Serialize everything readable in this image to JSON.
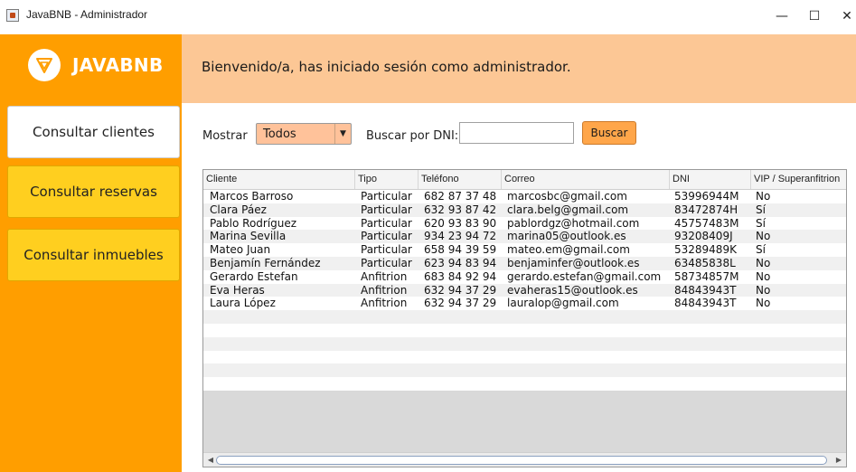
{
  "window": {
    "title": "JavaBNB - Administrador",
    "minimize": "—",
    "maximize": "☐",
    "close": "✕"
  },
  "brand": {
    "name": "JAVABNB",
    "colors": {
      "sidebar": "#ff9e00",
      "header": "#fcc795",
      "nav_active": "#ffffff",
      "nav_inactive": "#ffcf1f",
      "button": "#ffa64a"
    }
  },
  "sidebar": {
    "items": [
      {
        "label": "Consultar clientes",
        "active": true
      },
      {
        "label": "Consultar reservas",
        "active": false
      },
      {
        "label": "Consultar inmuebles",
        "active": false
      }
    ]
  },
  "header": {
    "welcome": "Bienvenido/a, has iniciado sesión como administrador."
  },
  "filters": {
    "show_label": "Mostrar",
    "show_selected": "Todos",
    "dni_label": "Buscar por DNI:",
    "dni_value": "",
    "search_button": "Buscar"
  },
  "table": {
    "columns": [
      "Cliente",
      "Tipo",
      "Teléfono",
      "Correo",
      "DNI",
      "VIP / Superanfitrion"
    ],
    "rows": [
      [
        "Marcos Barroso",
        "Particular",
        "682 87 37 48",
        "marcosbc@gmail.com",
        "53996944M",
        "No"
      ],
      [
        "Clara Páez",
        "Particular",
        "632 93 87 42",
        "clara.belg@gmail.com",
        "83472874H",
        "Sí"
      ],
      [
        "Pablo Rodríguez",
        "Particular",
        "620 93 83 90",
        "pablordgz@hotmail.com",
        "45757483M",
        "Sí"
      ],
      [
        "Marina Sevilla",
        "Particular",
        "934 23 94 72",
        "marina05@outlook.es",
        "93208409J",
        "No"
      ],
      [
        "Mateo Juan",
        "Particular",
        "658 94 39 59",
        "mateo.em@gmail.com",
        "53289489K",
        "Sí"
      ],
      [
        "Benjamín Fernández",
        "Particular",
        "623 94 83 94",
        "benjaminfer@outlook.es",
        "63485838L",
        "No"
      ],
      [
        "Gerardo Estefan",
        "Anfitrion",
        "683 84 92 94",
        "gerardo.estefan@gmail.com",
        "58734857M",
        "No"
      ],
      [
        "Eva Heras",
        "Anfitrion",
        "632 94 37 29",
        "evaheras15@outlook.es",
        "84843943T",
        "No"
      ],
      [
        "Laura López",
        "Anfitrion",
        "632 94 37 29",
        "lauralop@gmail.com",
        "84843943T",
        "No"
      ]
    ]
  },
  "icons": {
    "app": "java-cup-icon",
    "logo": "javabnb-logo-icon",
    "select_arrow": "chevron-down-icon"
  }
}
